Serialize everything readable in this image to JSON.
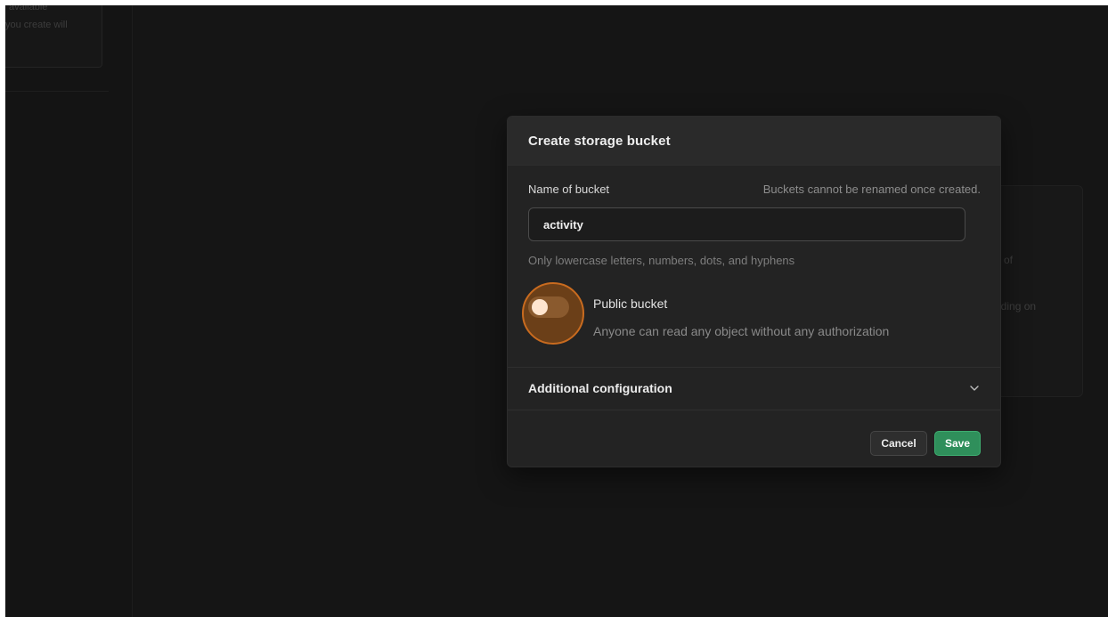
{
  "background": {
    "sidebar_text_lines": [
      "available",
      "you create will"
    ],
    "panel_text_lines": [
      "e of",
      "nding on"
    ]
  },
  "modal": {
    "title": "Create storage bucket",
    "name_label": "Name of bucket",
    "name_hint": "Buckets cannot be renamed once created.",
    "name_value": "activity",
    "name_help": "Only lowercase letters, numbers, dots, and hyphens",
    "public_toggle": {
      "label": "Public bucket",
      "description": "Anyone can read any object without any authorization",
      "checked": false
    },
    "additional_config_label": "Additional configuration",
    "cancel_label": "Cancel",
    "save_label": "Save"
  },
  "colors": {
    "accent_save": "#2f8f5b",
    "highlight": "#c96b1f",
    "background": "#151515"
  }
}
